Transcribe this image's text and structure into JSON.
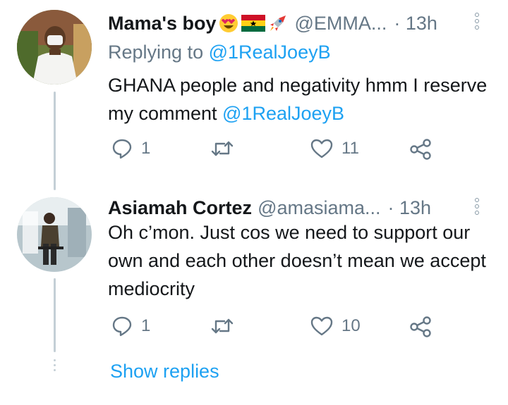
{
  "tweets": [
    {
      "name": "Mama's boy",
      "name_emojis": [
        "smiling-face-heart-eyes-emoji",
        "ghana-flag-emoji",
        "rocket-emoji"
      ],
      "handle": "@EMMA...",
      "time": "· 13h",
      "replying_label": "Replying to ",
      "replying_handle": "@1RealJoeyB",
      "text": "GHANA people and negativity hmm I reserve my comment ",
      "text_mention": "@1RealJoeyB",
      "replies": "1",
      "retweets": "",
      "likes": "11"
    },
    {
      "name": "Asiamah Cortez",
      "handle": "@amasiama...",
      "time": "· 13h",
      "text": "Oh c’mon. Just cos we need to support our own and each other doesn’t mean we accept mediocrity",
      "replies": "1",
      "retweets": "",
      "likes": "10"
    }
  ],
  "show_replies": "Show replies",
  "colors": {
    "accent": "#1da1f2",
    "muted": "#657786",
    "text": "#14171a",
    "thread_line": "#c4cfd6"
  },
  "icons": [
    "reply-icon",
    "retweet-icon",
    "like-icon",
    "share-icon",
    "more-options-icon"
  ]
}
